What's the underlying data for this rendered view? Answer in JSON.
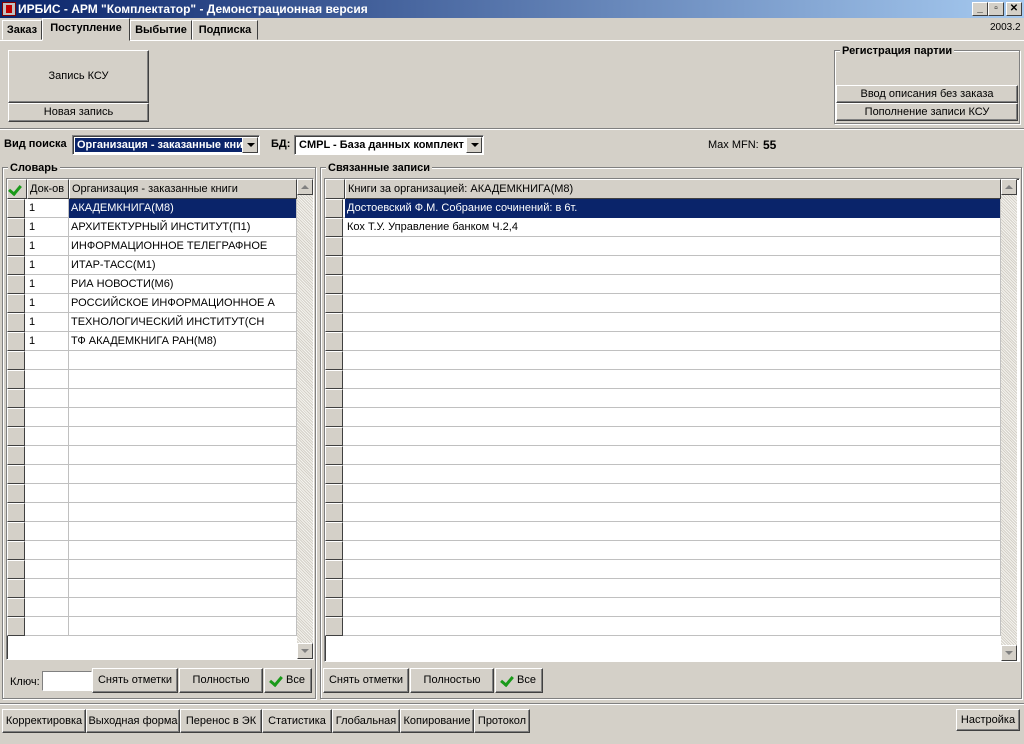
{
  "window": {
    "title": "ИРБИС - АРМ \"Комплектатор\" - Демонстрационная версия",
    "version": "2003.2",
    "controls": [
      "minimize",
      "restore",
      "close"
    ]
  },
  "tabs": [
    {
      "label": "Заказ",
      "active": false
    },
    {
      "label": "Поступление",
      "active": true
    },
    {
      "label": "Выбытие",
      "active": false
    },
    {
      "label": "Подписка",
      "active": false
    }
  ],
  "top": {
    "ksu_record_label": "Запись КСУ",
    "new_record_label": "Новая запись",
    "batch_group_title": "Регистрация партии",
    "batch_no_order_label": "Ввод описания без заказа",
    "batch_ksu_label": "Пополнение записи КСУ"
  },
  "search": {
    "type_label": "Вид поиска",
    "type_value": "Организация - заказанные кни",
    "db_label": "БД:",
    "db_value": "CMPL - База данных комплект",
    "maxmfn_label": "Max MFN:",
    "maxmfn_value": "55"
  },
  "dictionary": {
    "title": "Словарь",
    "col_count": "Док-ов",
    "col_name": "Организация - заказанные книги",
    "rows": [
      {
        "count": "1",
        "name": "АКАДЕМКНИГА(М8)",
        "selected": true
      },
      {
        "count": "1",
        "name": "АРХИТЕКТУРНЫЙ ИНСТИТУТ(П1)",
        "selected": false
      },
      {
        "count": "1",
        "name": "ИНФОРМАЦИОННОЕ ТЕЛЕГРАФНОЕ",
        "selected": false
      },
      {
        "count": "1",
        "name": "ИТАР-ТАСС(М1)",
        "selected": false
      },
      {
        "count": "1",
        "name": "РИА НОВОСТИ(М6)",
        "selected": false
      },
      {
        "count": "1",
        "name": "РОССИЙСКОЕ ИНФОРМАЦИОННОЕ А",
        "selected": false
      },
      {
        "count": "1",
        "name": "ТЕХНОЛОГИЧЕСКИЙ ИНСТИТУТ(СН",
        "selected": false
      },
      {
        "count": "1",
        "name": "ТФ АКАДЕМКНИГА РАН(М8)",
        "selected": false
      }
    ],
    "key_label": "Ключ:",
    "key_value": "",
    "clear_marks_label": "Снять отметки",
    "full_label": "Полностью",
    "all_label": "Все"
  },
  "related": {
    "title": "Связанные записи",
    "col_header": "Книги за организацией: АКАДЕМКНИГА(М8)",
    "rows": [
      {
        "text": "Достоевский Ф.М. Собрание сочинений: в 6т.",
        "selected": true
      },
      {
        "text": "Кох Т.У. Управление банком Ч.2,4",
        "selected": false
      }
    ],
    "clear_marks_label": "Снять отметки",
    "full_label": "Полностью",
    "all_label": "Все"
  },
  "bottom_toolbar": [
    "Корректировка",
    "Выходная форма",
    "Перенос в ЭК",
    "Статистика",
    "Глобальная",
    "Копирование",
    "Протокол"
  ],
  "settings_label": "Настройка",
  "colors": {
    "face": "#d4d0c8",
    "title_start": "#0a246a",
    "title_end": "#a6caf0",
    "selection": "#0a246a",
    "check": "#1a9a1a"
  },
  "icons": [
    "app-icon",
    "minimize-icon",
    "restore-icon",
    "close-icon",
    "check-icon",
    "scroll-up-icon",
    "scroll-down-icon",
    "dropdown-arrow-icon"
  ]
}
